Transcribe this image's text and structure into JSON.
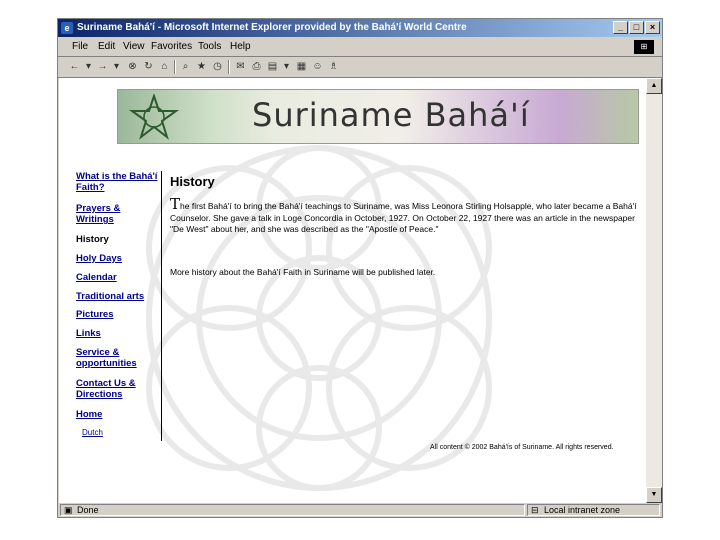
{
  "window": {
    "title": "Suriname Bahá'í - Microsoft Internet Explorer provided by the Bahá'í World Centre",
    "minimize": "_",
    "maximize": "□",
    "close": "×"
  },
  "menu": [
    "File",
    "Edit",
    "View",
    "Favorites",
    "Tools",
    "Help"
  ],
  "toolbar_icons": [
    "back-icon",
    "forward-icon",
    "stop-icon",
    "refresh-icon",
    "home-icon",
    "search-icon",
    "favorites-icon",
    "history-icon",
    "mail-icon",
    "print-icon",
    "edit-icon",
    "discuss-icon",
    "messenger-icon"
  ],
  "banner": {
    "title": "Suriname Bahá'í"
  },
  "nav": [
    {
      "label": "What is the Bahá'í Faith?"
    },
    {
      "label": "Prayers & Writings"
    },
    {
      "label": "History"
    },
    {
      "label": "Holy Days"
    },
    {
      "label": "Calendar"
    },
    {
      "label": "Traditional arts"
    },
    {
      "label": "Pictures"
    },
    {
      "label": "Links"
    },
    {
      "label": "Service & opportunities"
    },
    {
      "label": "Contact Us & Directions"
    },
    {
      "label": "Home"
    },
    {
      "label": "Dutch"
    }
  ],
  "main": {
    "heading": "History",
    "drop_cap": "T",
    "para1": "he first Bahá'í to bring the Bahá'í teachings to Suriname, was Miss Leonora Stirling Holsapple, who later became a Bahá'í Counselor. She gave a talk in Loge Concordia in October, 1927. On October 22, 1927 there was an article in the newspaper \"De West\" about her, and she was described as the \"Apostle of Peace.\"",
    "para2": "More history about the Bahá'í Faith in Suriname will be published later."
  },
  "footer": {
    "copyright": "All content © 2002 Bahá'ís of Suriname. All rights reserved."
  },
  "status": {
    "text": "Done",
    "zone": "Local intranet zone"
  }
}
